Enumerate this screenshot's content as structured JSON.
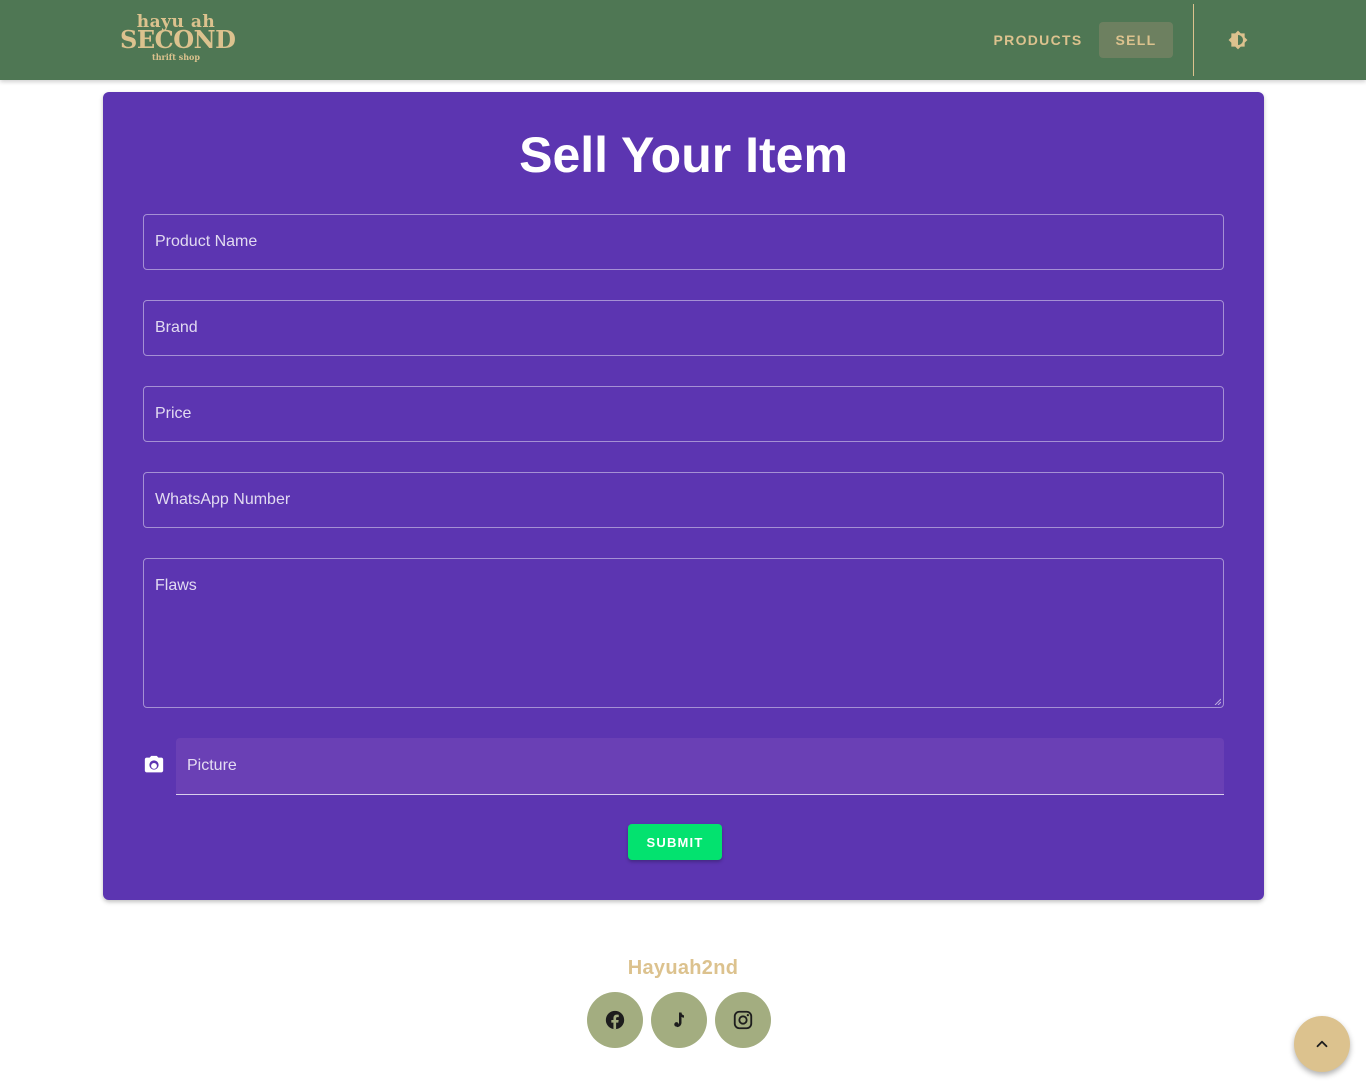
{
  "header": {
    "logo": {
      "line1": "hayu ah",
      "line2": "SECOND",
      "line3": "thrift shop"
    },
    "nav": {
      "products_label": "PRODUCTS",
      "sell_label": "SELL"
    },
    "theme_toggle_icon": "brightness-icon"
  },
  "form": {
    "title": "Sell Your Item",
    "fields": {
      "product_name": {
        "label": "Product Name",
        "value": ""
      },
      "brand": {
        "label": "Brand",
        "value": ""
      },
      "price": {
        "label": "Price",
        "value": ""
      },
      "whatsapp": {
        "label": "WhatsApp Number",
        "value": ""
      },
      "flaws": {
        "label": "Flaws",
        "value": ""
      },
      "picture": {
        "label": "Picture",
        "icon": "camera-icon"
      }
    },
    "submit_label": "SUBMIT"
  },
  "footer": {
    "brand": "Hayuah2nd",
    "social": [
      "facebook-icon",
      "tiktok-icon",
      "instagram-icon"
    ]
  },
  "scroll_top_icon": "chevron-up-icon",
  "colors": {
    "header_bg": "#4f7754",
    "accent_gold": "#dcc28e",
    "card_bg": "#5c35b1",
    "submit_bg": "#03e26f",
    "social_bg": "#a3ad80"
  }
}
